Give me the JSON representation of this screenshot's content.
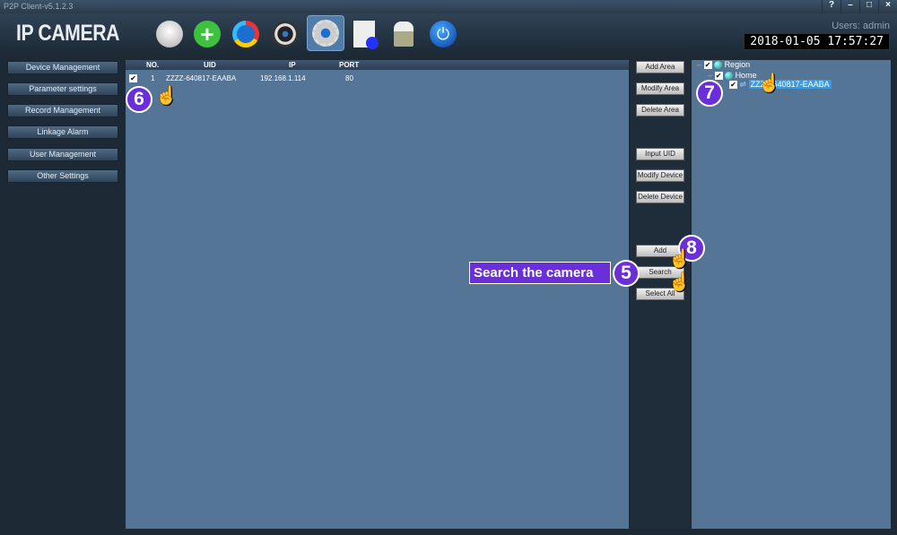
{
  "window": {
    "title": "P2P Client-v5.1.2.3",
    "controls": [
      "?",
      "–",
      "□",
      "×"
    ]
  },
  "header": {
    "logo": "IP CAMERA",
    "users": "Users: admin",
    "datetime": "2018-01-05 17:57:27",
    "tools": [
      "camera-icon",
      "add-icon",
      "play-icon",
      "reel-icon",
      "settings-icon",
      "log-icon",
      "lock-icon",
      "power-icon"
    ]
  },
  "sidebar": {
    "items": [
      "Device Management",
      "Parameter settings",
      "Record Management",
      "Linkage Alarm",
      "User Management",
      "Other Settings"
    ]
  },
  "table": {
    "columns": [
      "NO.",
      "UID",
      "IP",
      "PORT"
    ],
    "rows": [
      {
        "checked": true,
        "no": "1",
        "uid": "ZZZZ-640817-EAABA",
        "ip": "192.168.1.114",
        "port": "80"
      }
    ]
  },
  "buttons": {
    "add_area": "Add Area",
    "modify_area": "Modify Area",
    "delete_area": "Delete Area",
    "input_uid": "Input UID",
    "modify_device": "Modify Device",
    "delete_device": "Delete Device",
    "add": "Add",
    "search": "Search",
    "select_all": "Select All"
  },
  "tree": {
    "region": "Region",
    "home": "Home",
    "device": "ZZZZ-640817-EAABA"
  },
  "annotations": {
    "callout": "Search the camera",
    "steps": [
      "5",
      "6",
      "7",
      "8"
    ]
  },
  "colors": {
    "accent": "#6a2fd8",
    "panel": "#557596"
  }
}
